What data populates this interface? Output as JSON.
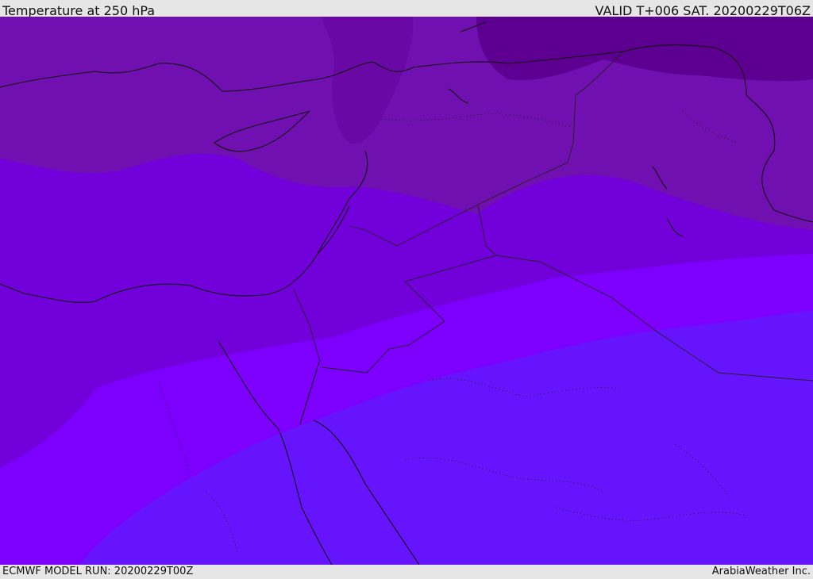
{
  "header": {
    "title": "Temperature at 250 hPa",
    "valid": "VALID T+006 SAT. 20200229T06Z"
  },
  "footer": {
    "model_run": "ECMWF MODEL RUN: 20200229T00Z",
    "credit": "ArabiaWeather Inc."
  },
  "colors": {
    "very_cold": "#5d0092",
    "cold": "#7010b0",
    "mid": "#7200da",
    "warm": "#7d00ff",
    "warmest": "#6614fe",
    "coastline": "#111111",
    "frame": "#e6e6e6"
  }
}
